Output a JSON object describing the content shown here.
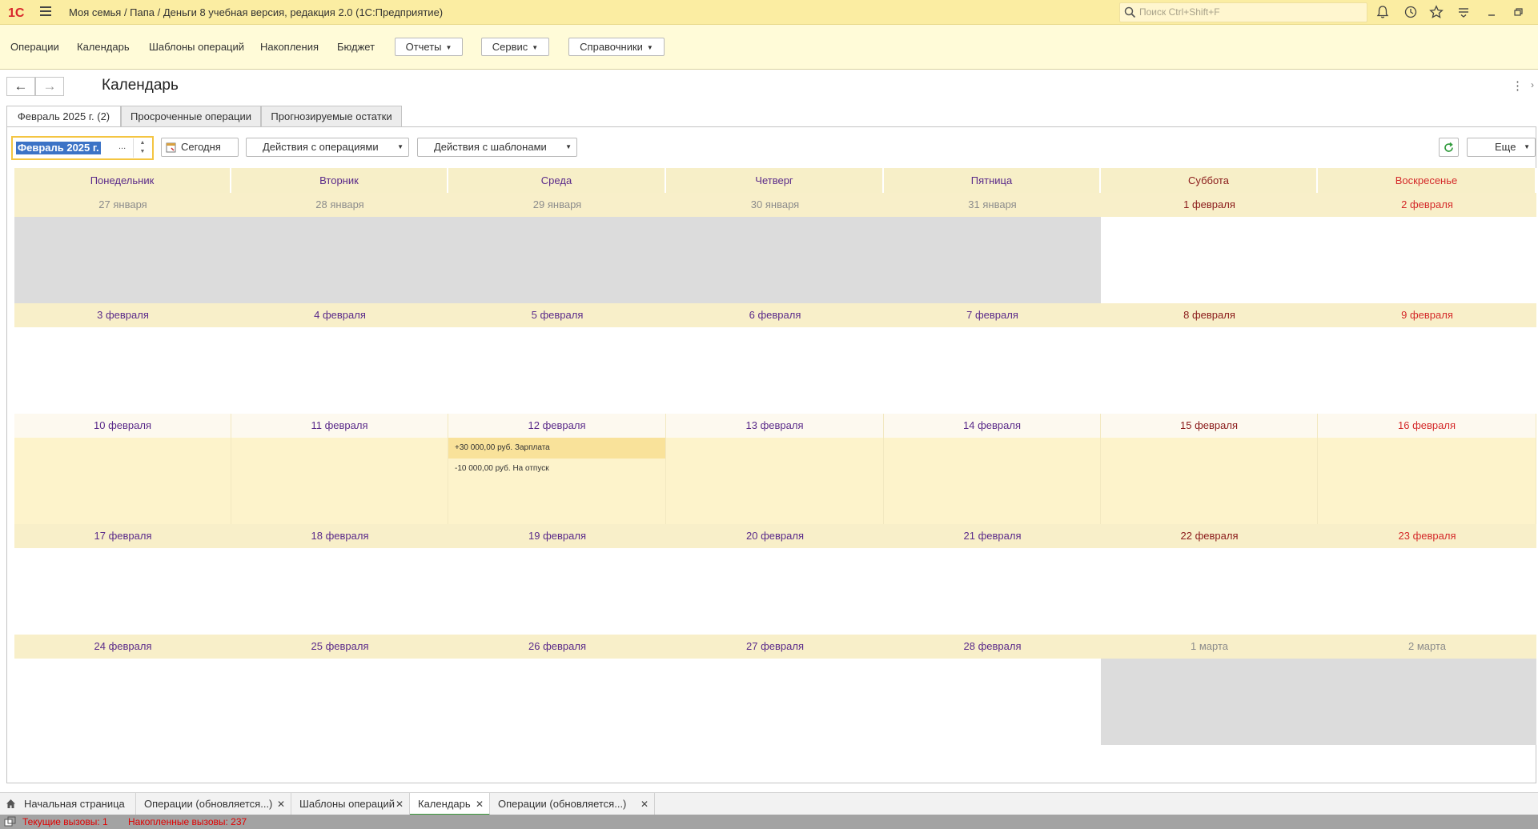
{
  "window": {
    "title": "Моя семья / Папа / Деньги 8 учебная версия, редакция 2.0  (1С:Предприятие)",
    "search_placeholder": "Поиск Ctrl+Shift+F",
    "logo_text": "1С"
  },
  "menu": {
    "items": [
      "Операции",
      "Календарь",
      "Шаблоны операций",
      "Накопления",
      "Бюджет"
    ],
    "dropdowns": [
      "Отчеты",
      "Сервис",
      "Справочники"
    ]
  },
  "page": {
    "title": "Календарь",
    "tabs": [
      "Февраль 2025 г. (2)",
      "Просроченные операции",
      "Прогнозируемые остатки"
    ]
  },
  "toolbar": {
    "period_value": "Февраль 2025 г.",
    "period_dots": "...",
    "today_label": "Сегодня",
    "ops_actions_label": "Действия с операциями",
    "tpl_actions_label": "Действия с шаблонами",
    "more_label": "Еще"
  },
  "calendar": {
    "weekdays": [
      "Понедельник",
      "Вторник",
      "Среда",
      "Четверг",
      "Пятница",
      "Суббота",
      "Воскресенье"
    ],
    "weeks": [
      [
        {
          "label": "27 января",
          "other": true
        },
        {
          "label": "28 января",
          "other": true
        },
        {
          "label": "29 января",
          "other": true
        },
        {
          "label": "30 января",
          "other": true
        },
        {
          "label": "31 января",
          "other": true
        },
        {
          "label": "1 февраля"
        },
        {
          "label": "2 февраля"
        }
      ],
      [
        {
          "label": "3 февраля"
        },
        {
          "label": "4 февраля"
        },
        {
          "label": "5 февраля"
        },
        {
          "label": "6 февраля"
        },
        {
          "label": "7 февраля"
        },
        {
          "label": "8 февраля"
        },
        {
          "label": "9 февраля"
        }
      ],
      [
        {
          "label": "10 февраля"
        },
        {
          "label": "11 февраля"
        },
        {
          "label": "12 февраля",
          "ops": [
            "+30 000,00 руб. Зарплата",
            "-10 000,00 руб. На отпуск"
          ]
        },
        {
          "label": "13 февраля"
        },
        {
          "label": "14 февраля"
        },
        {
          "label": "15 февраля"
        },
        {
          "label": "16 февраля"
        }
      ],
      [
        {
          "label": "17 февраля"
        },
        {
          "label": "18 февраля"
        },
        {
          "label": "19 февраля"
        },
        {
          "label": "20 февраля"
        },
        {
          "label": "21 февраля"
        },
        {
          "label": "22 февраля"
        },
        {
          "label": "23 февраля"
        }
      ],
      [
        {
          "label": "24 февраля"
        },
        {
          "label": "25 февраля"
        },
        {
          "label": "26 февраля"
        },
        {
          "label": "27 февраля"
        },
        {
          "label": "28 февраля"
        },
        {
          "label": "1 марта",
          "other": true
        },
        {
          "label": "2 марта",
          "other": true
        }
      ]
    ]
  },
  "bottom_tabs": [
    {
      "label": "Начальная страница",
      "closable": false
    },
    {
      "label": "Операции (обновляется...)",
      "closable": true
    },
    {
      "label": "Шаблоны операций",
      "closable": true
    },
    {
      "label": "Календарь",
      "closable": true,
      "active": true
    },
    {
      "label": "Операции (обновляется...)",
      "closable": true
    }
  ],
  "status": {
    "current_calls": "Текущие вызовы: 1",
    "accumulated_calls": "Накопленные вызовы: 237"
  },
  "colors": {
    "titlebar": "#fbeda2",
    "accent_red": "#e00000",
    "weekday_text": "#5a2a8a",
    "sunday_text": "#d42a2a"
  }
}
